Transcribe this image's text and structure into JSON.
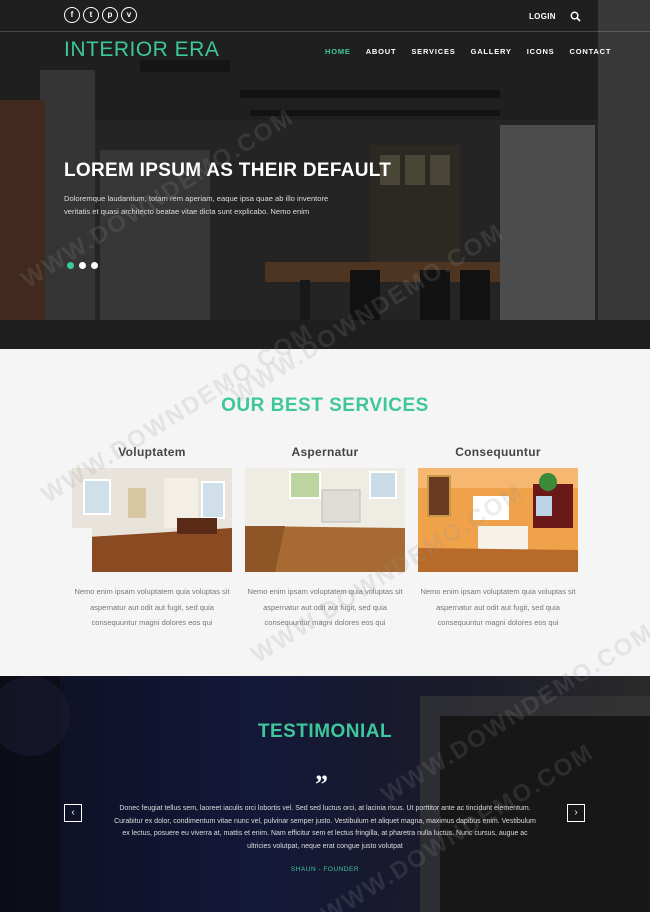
{
  "header": {
    "social": [
      {
        "icon": "facebook-icon",
        "glyph": "f"
      },
      {
        "icon": "twitter-icon",
        "glyph": "t"
      },
      {
        "icon": "pinterest-icon",
        "glyph": "p"
      },
      {
        "icon": "vimeo-icon",
        "glyph": "v"
      }
    ],
    "login_label": "LOGIN",
    "logo": "INTERIOR ERA",
    "nav": [
      {
        "label": "HOME",
        "active": true
      },
      {
        "label": "ABOUT",
        "active": false
      },
      {
        "label": "SERVICES",
        "active": false
      },
      {
        "label": "GALLERY",
        "active": false
      },
      {
        "label": "ICONS",
        "active": false
      },
      {
        "label": "CONTACT",
        "active": false
      }
    ]
  },
  "hero": {
    "title": "LOREM IPSUM AS THEIR DEFAULT",
    "text": "Doloremque laudantium, totam rem aperiam, eaque ipsa quae ab illo inventore veritatis et quasi architecto beatae vitae dicta sunt explicabo. Nemo enim",
    "slides": 3,
    "active_slide": 1
  },
  "services": {
    "title": "OUR BEST SERVICES",
    "items": [
      {
        "title": "Voluptatem",
        "text": "Nemo enim ipsam voluptatem quia voluptas sit aspernatur aut odit aut fugit, sed quia consequuntur magni dolores eos qui"
      },
      {
        "title": "Aspernatur",
        "text": "Nemo enim ipsam voluptatem quia voluptas sit aspernatur aut odit aut fugit, sed quia consequuntur magni dolores eos qui"
      },
      {
        "title": "Consequuntur",
        "text": "Nemo enim ipsam voluptatem quia voluptas sit aspernatur aut odit aut fugit, sed quia consequuntur magni dolores eos qui"
      }
    ]
  },
  "testimonial": {
    "title": "TESTIMONIAL",
    "text": "Donec feugiat tellus sem, laoreet iaculis orci lobortis vel. Sed sed luctus orci, at lacinia risus. Ut porttitor ante ac tincidunt elementum. Curabitur ex dolor, condimentum vitae nunc vel, pulvinar semper justo. Vestibulum et aliquet magna, maximus dapibus enim. Vestibulum ex lectus, posuere eu viverra at, mattis et enim. Nam efficitur sem et lectus fringilla, at pharetra nulla luctus. Nunc cursus, augue ac ultricies volutpat, neque erat congue justo volutpat",
    "author": "SHAUN - FOUNDER",
    "prev_label": "‹",
    "next_label": "›"
  },
  "watermark": "WWW.DOWNDEMO.COM",
  "colors": {
    "accent": "#3ec79a"
  }
}
